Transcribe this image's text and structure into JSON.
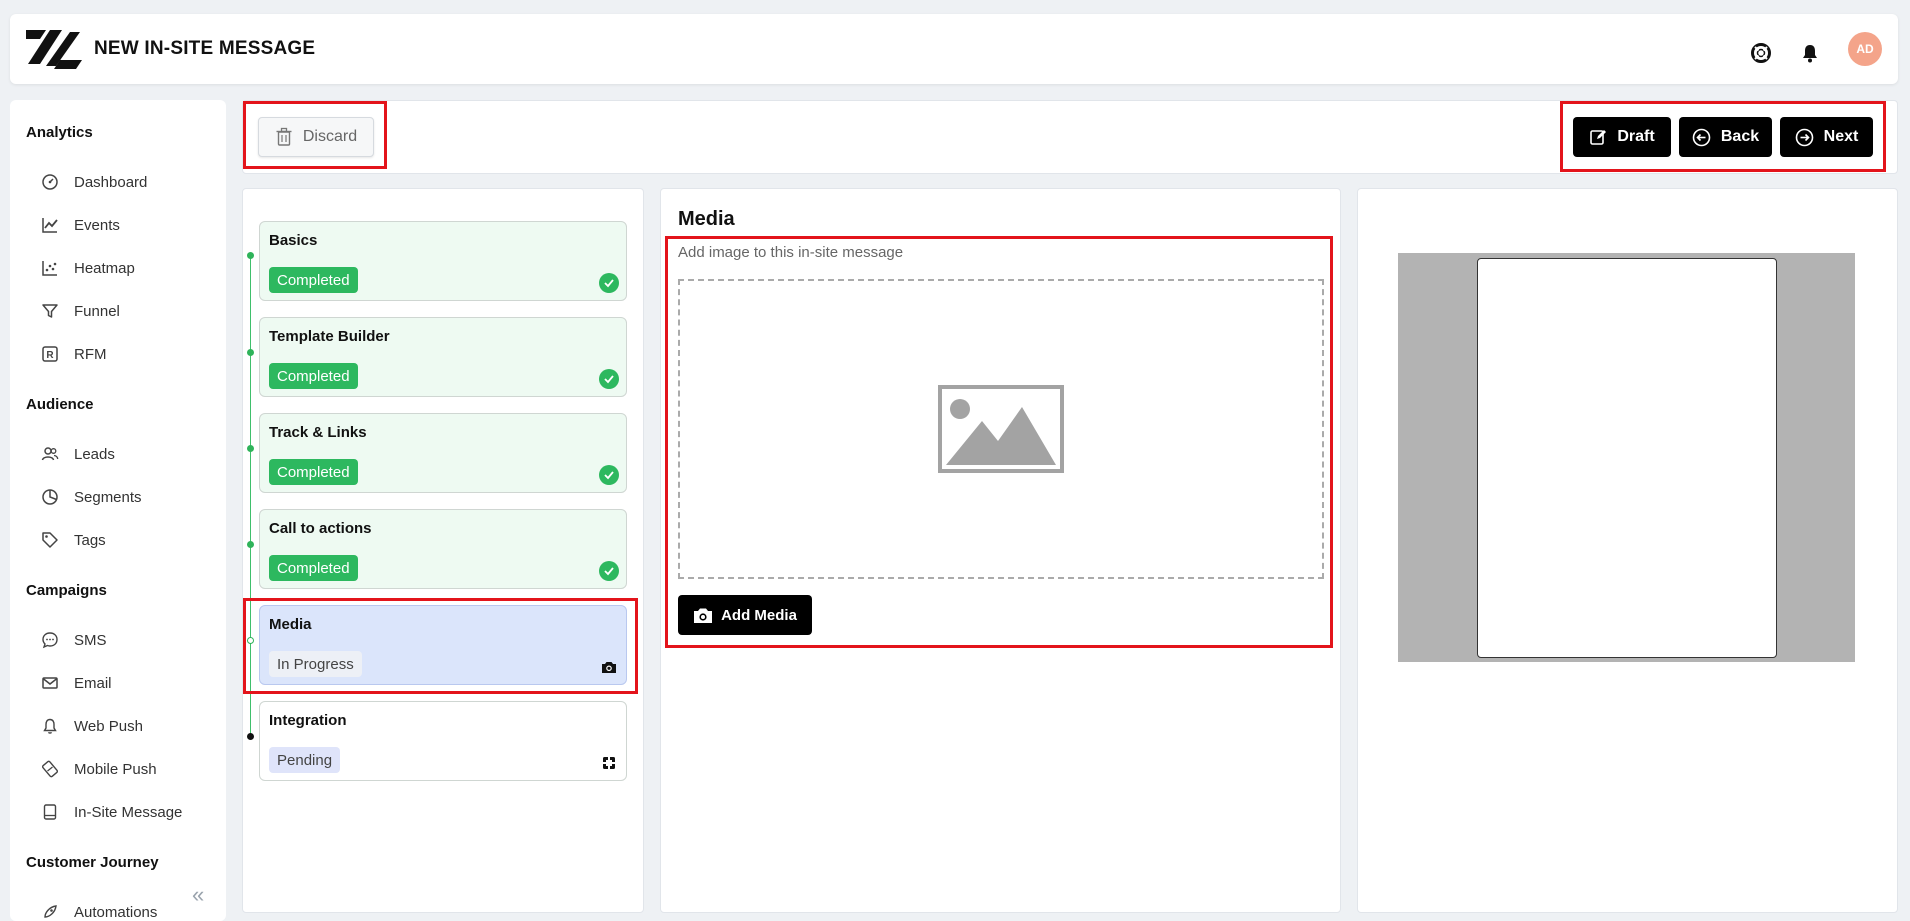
{
  "header": {
    "title": "NEW IN-SITE MESSAGE",
    "avatar_initials": "AD",
    "icons": [
      "support-icon",
      "bell-icon"
    ]
  },
  "sidebar": {
    "sections": [
      {
        "title": "Analytics",
        "items": [
          {
            "label": "Dashboard",
            "icon": "gauge-icon"
          },
          {
            "label": "Events",
            "icon": "line-chart-icon"
          },
          {
            "label": "Heatmap",
            "icon": "scatter-chart-icon"
          },
          {
            "label": "Funnel",
            "icon": "funnel-icon"
          },
          {
            "label": "RFM",
            "icon": "rfm-icon"
          }
        ]
      },
      {
        "title": "Audience",
        "items": [
          {
            "label": "Leads",
            "icon": "users-icon"
          },
          {
            "label": "Segments",
            "icon": "pie-chart-icon"
          },
          {
            "label": "Tags",
            "icon": "tag-icon"
          }
        ]
      },
      {
        "title": "Campaigns",
        "items": [
          {
            "label": "SMS",
            "icon": "sms-bubble-icon"
          },
          {
            "label": "Email",
            "icon": "envelope-icon"
          },
          {
            "label": "Web Push",
            "icon": "bell-icon"
          },
          {
            "label": "Mobile Push",
            "icon": "mobile-push-icon"
          },
          {
            "label": "In-Site Message",
            "icon": "in-site-message-icon"
          }
        ]
      },
      {
        "title": "Customer Journey",
        "items": [
          {
            "label": "Automations",
            "icon": "rocket-icon"
          }
        ]
      }
    ]
  },
  "toolbar": {
    "discard_label": "Discard",
    "draft_label": "Draft",
    "back_label": "Back",
    "next_label": "Next"
  },
  "steps": [
    {
      "title": "Basics",
      "status": "Completed"
    },
    {
      "title": "Template Builder",
      "status": "Completed"
    },
    {
      "title": "Track & Links",
      "status": "Completed"
    },
    {
      "title": "Call to actions",
      "status": "Completed"
    },
    {
      "title": "Media",
      "status": "In Progress"
    },
    {
      "title": "Integration",
      "status": "Pending"
    }
  ],
  "media": {
    "title": "Media",
    "subtitle": "Add image to this in-site message",
    "add_button": "Add Media"
  },
  "colors": {
    "highlight": "#e3141b",
    "completed": "#2db85f",
    "in_progress_bg": "#dbe5fb",
    "avatar": "#f4a48a"
  }
}
